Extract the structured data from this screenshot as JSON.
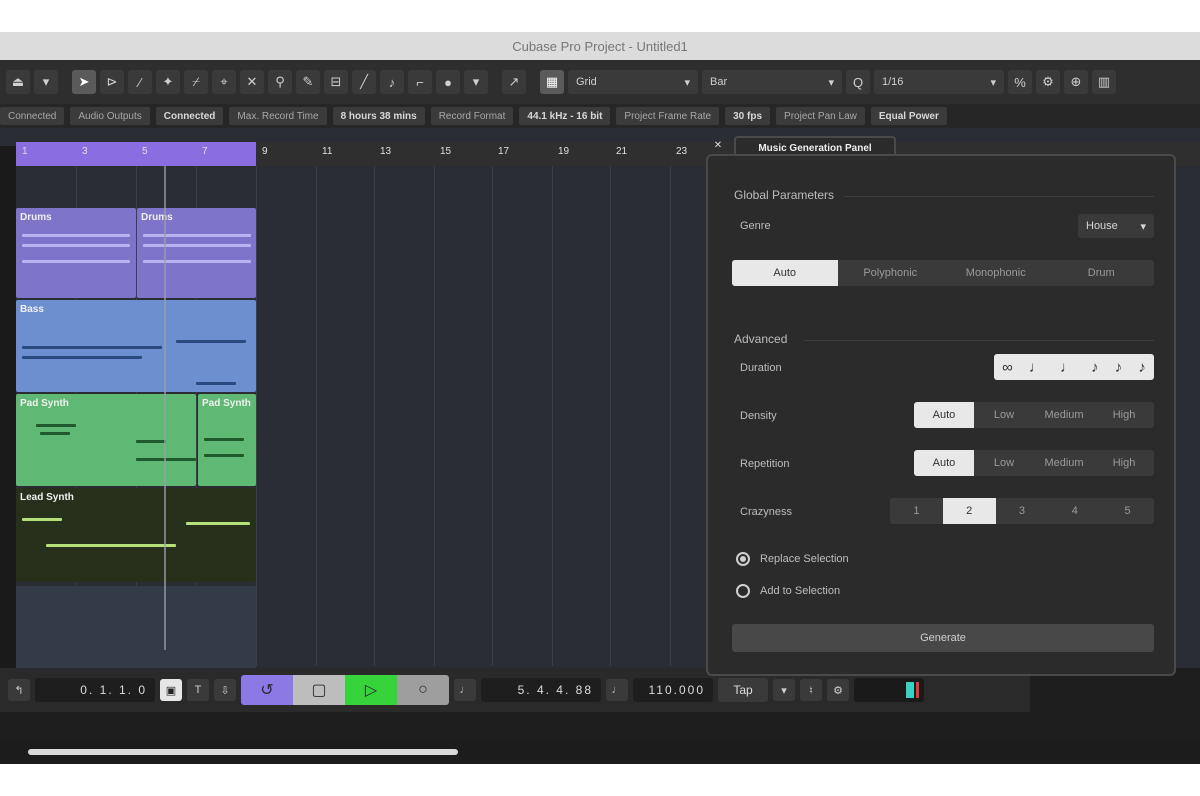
{
  "window": {
    "title": "Cubase Pro Project - Untitled1"
  },
  "toolbar": {
    "grid_type": "Grid",
    "quantize_display": "1/16",
    "snap_value": "Bar"
  },
  "infobar": {
    "items": [
      {
        "label": "Connected"
      },
      {
        "label": "Audio Outputs",
        "value": "Connected"
      },
      {
        "label": "Max. Record Time",
        "value": "8 hours 38 mins"
      },
      {
        "label": "Record Format",
        "value": "44.1 kHz - 16 bit"
      },
      {
        "label": "Project Frame Rate",
        "value": "30 fps"
      },
      {
        "label": "Project Pan Law",
        "value": "Equal Power"
      }
    ]
  },
  "ruler": {
    "loop_marks": [
      "1",
      "3",
      "5",
      "7"
    ],
    "bars": [
      "9",
      "11",
      "13",
      "15",
      "17",
      "19",
      "21",
      "23"
    ]
  },
  "tracks": [
    {
      "name": "Drums",
      "color": "#7e74c9",
      "parts": [
        "Drums",
        "Drums"
      ]
    },
    {
      "name": "Bass",
      "color": "#6b8fcf",
      "parts": [
        "Bass"
      ]
    },
    {
      "name": "Pad Synth",
      "color": "#5fb874",
      "parts": [
        "Pad Synth",
        "Pad Synth"
      ]
    },
    {
      "name": "Lead Synth",
      "color": "#26301a",
      "parts": [
        "Lead Synth"
      ]
    }
  ],
  "transport": {
    "left_locator": "0. 1. 1.   0",
    "right_locator": "5. 4. 4. 88",
    "tempo": "110.000",
    "tap_label": "Tap"
  },
  "panel": {
    "tab_title": "Music Generation Panel",
    "global_title": "Global Parameters",
    "genre_label": "Genre",
    "genre_value": "House",
    "modes": [
      "Auto",
      "Polyphonic",
      "Monophonic",
      "Drum"
    ],
    "modes_selected": 0,
    "advanced_title": "Advanced",
    "duration_label": "Duration",
    "duration_symbols": [
      "∞",
      "♩",
      "♩",
      "♪",
      "♪",
      "♪"
    ],
    "density_label": "Density",
    "density_options": [
      "Auto",
      "Low",
      "Medium",
      "High"
    ],
    "density_selected": 0,
    "repetition_label": "Repetition",
    "repetition_options": [
      "Auto",
      "Low",
      "Medium",
      "High"
    ],
    "repetition_selected": 0,
    "craziness_label": "Crazyness",
    "craziness_options": [
      "1",
      "2",
      "3",
      "4",
      "5"
    ],
    "craziness_selected": 1,
    "replace_label": "Replace Selection",
    "add_label": "Add to Selection",
    "replace_selected": true,
    "generate_label": "Generate"
  }
}
